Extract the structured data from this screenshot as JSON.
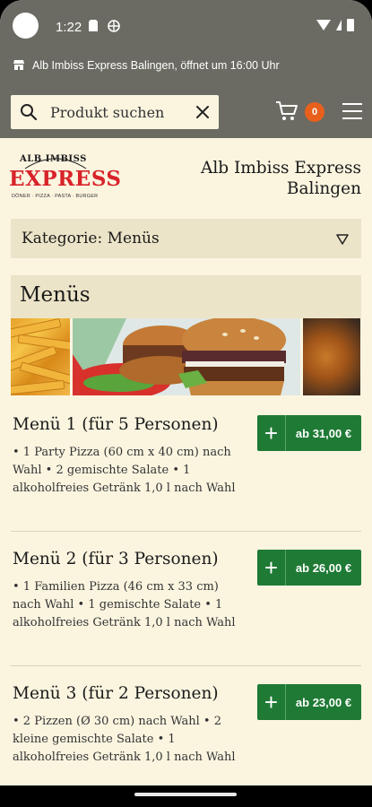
{
  "status_bar": {
    "time": "1:22"
  },
  "info_banner": {
    "text": "Alb Imbiss Express Balingen, öffnet um 16:00 Uhr"
  },
  "header": {
    "search_placeholder": "Produkt suchen",
    "cart_count": "0"
  },
  "brand": {
    "logo_top": "ALB IMBISS",
    "logo_main": "EXPRESS",
    "logo_sub": "DÖNER · PIZZA · PASTA · BURGER",
    "name_line1": "Alb Imbiss Express",
    "name_line2": "Balingen"
  },
  "category": {
    "label": "Kategorie: Menüs"
  },
  "section": {
    "title": "Menüs"
  },
  "products": [
    {
      "title": "Menü 1 (für 5 Personen)",
      "description": "• 1 Party Pizza (60 cm x 40 cm) nach Wahl • 2 gemischte Salate • 1 alkoholfreies Getränk 1,0 l nach Wahl",
      "price": "ab 31,00 €"
    },
    {
      "title": "Menü 2 (für 3 Personen)",
      "description": "• 1 Familien Pizza (46 cm x 33 cm) nach Wahl • 1 gemischte Salate • 1 alkoholfreies Getränk 1,0 l nach Wahl",
      "price": "ab 26,00 €"
    },
    {
      "title": "Menü 3 (für 2 Personen)",
      "description": "• 2 Pizzen (Ø 30 cm) nach Wahl • 2 kleine gemischte Salate • 1 alkoholfreies Getränk 1,0 l nach Wahl",
      "price": "ab 23,00 €"
    }
  ],
  "colors": {
    "header_bg": "#6b6b63",
    "page_bg": "#fbf5e0",
    "accent_green": "#1f7a35",
    "cart_badge": "#e8601c",
    "brand_red": "#d8232a"
  }
}
